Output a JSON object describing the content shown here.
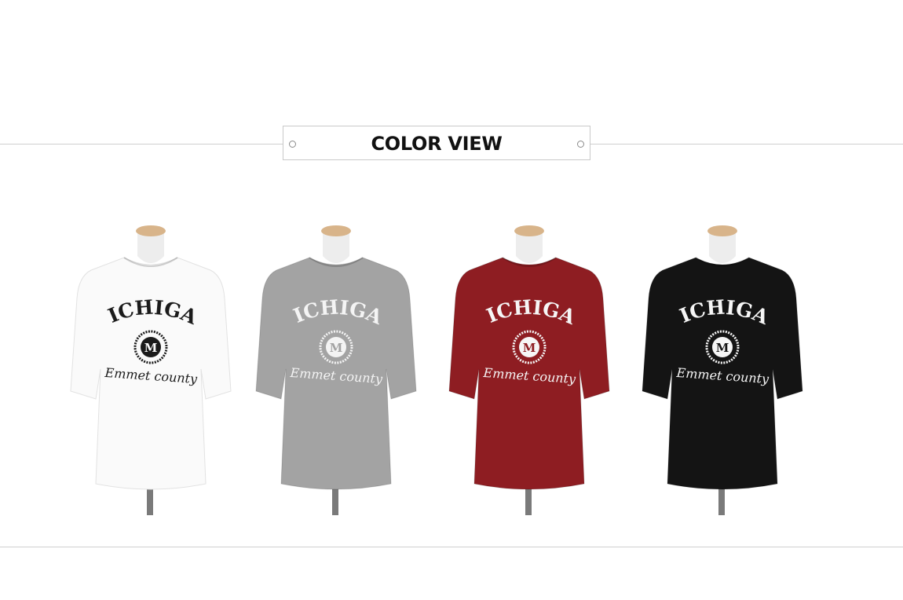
{
  "section": {
    "title": "COLOR VIEW"
  },
  "products": [
    {
      "shirt_color": "#fafafa",
      "print_color": "#1b1b1b",
      "words": {
        "arch": "MICHIGAN",
        "monogram": "M",
        "script": "Emmet county"
      }
    },
    {
      "shirt_color": "#a3a3a3",
      "print_color": "#f4f4f4",
      "words": {
        "arch": "MICHIGAN",
        "monogram": "M",
        "script": "Emmet county"
      }
    },
    {
      "shirt_color": "#8e1d22",
      "print_color": "#f6f6f6",
      "words": {
        "arch": "MICHIGAN",
        "monogram": "M",
        "script": "Emmet county"
      }
    },
    {
      "shirt_color": "#141414",
      "print_color": "#f6f6f6",
      "words": {
        "arch": "MICHIGAN",
        "monogram": "M",
        "script": "Emmet county"
      }
    }
  ],
  "colors": {
    "rule": "#cfcfcf",
    "title_border": "#c9c9c9",
    "mannequin_neck": "#d8b48a"
  }
}
